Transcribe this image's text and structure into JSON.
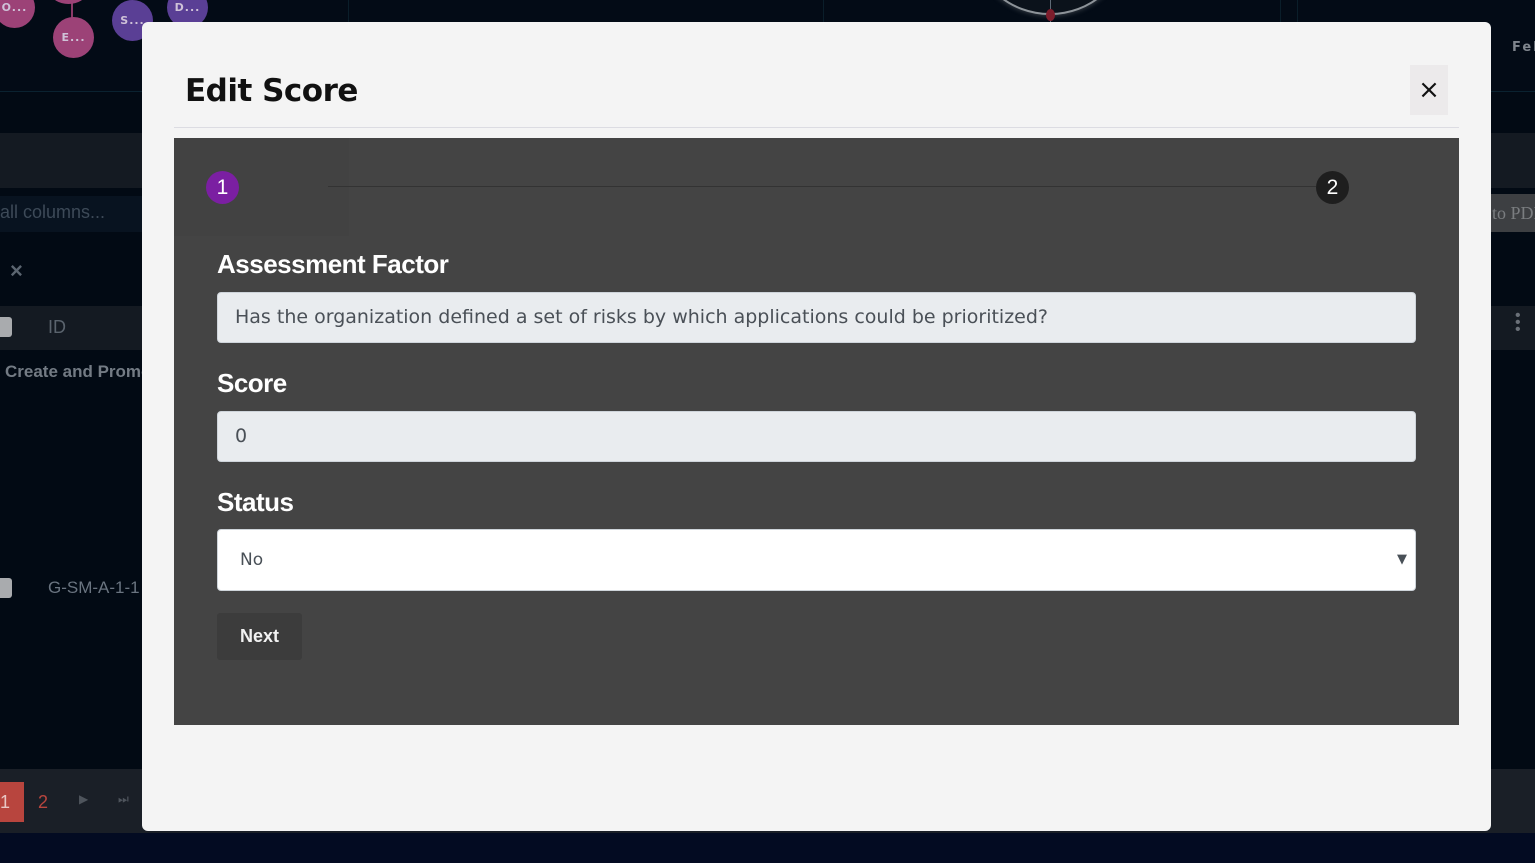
{
  "background": {
    "nodes": [
      {
        "label": "O...",
        "color": "pink"
      },
      {
        "label": "E...",
        "color": "pink"
      },
      {
        "label": "S...",
        "color": "purple"
      },
      {
        "label": "D...",
        "color": "purple"
      }
    ],
    "month_label": "Feb",
    "search_placeholder": "all columns...",
    "export_button": "to PDF",
    "clear_filter_icon": "×",
    "table": {
      "header_id": "ID",
      "group_label": "Create and Promote",
      "row_id": "G-SM-A-1-1",
      "column_menu_icon": "⋮"
    },
    "pagination": {
      "pages": [
        "1",
        "2"
      ],
      "current_page": "1",
      "next_icon": "▶",
      "last_icon": "⏭"
    }
  },
  "modal": {
    "title": "Edit Score",
    "close_icon": "×",
    "stepper": {
      "steps": [
        "1",
        "2"
      ],
      "current_step": 1,
      "active_color": "#7b1fa2"
    },
    "fields": {
      "assessment_factor": {
        "label": "Assessment Factor",
        "value": "Has the organization defined a set of risks by which applications could be prioritized?"
      },
      "score": {
        "label": "Score",
        "value": "0"
      },
      "status": {
        "label": "Status",
        "value": "No",
        "arrow_icon": "▼"
      }
    },
    "next_button": "Next"
  }
}
